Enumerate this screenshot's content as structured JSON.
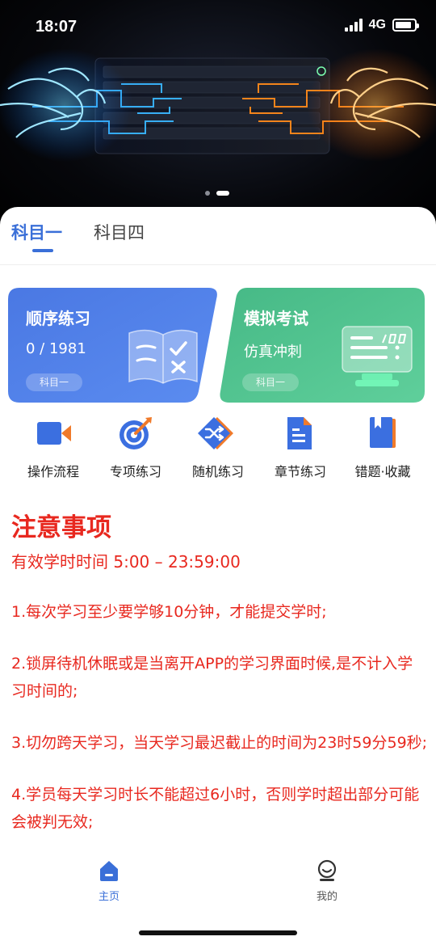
{
  "status_bar": {
    "time": "18:07",
    "network": "4G",
    "battery_level": 0.85
  },
  "banner": {
    "slides": 2,
    "active_slide": 2
  },
  "tabs": [
    {
      "label": "科目一",
      "active": true
    },
    {
      "label": "科目四",
      "active": false
    }
  ],
  "cards": {
    "sequential": {
      "title": "顺序练习",
      "progress": "0 / 1981",
      "tag": "科目一"
    },
    "mock_exam": {
      "title": "模拟考试",
      "subtitle": "仿真冲刺",
      "tag": "科目一"
    }
  },
  "shortcuts": [
    {
      "label": "操作流程",
      "icon": "video-camera-icon"
    },
    {
      "label": "专项练习",
      "icon": "target-icon"
    },
    {
      "label": "随机练习",
      "icon": "shuffle-icon"
    },
    {
      "label": "章节练习",
      "icon": "document-icon"
    },
    {
      "label": "错题·收藏",
      "icon": "bookmark-book-icon"
    }
  ],
  "notice": {
    "title": "注意事项",
    "hours": "有效学时时间 5:00 – 23:59:00",
    "items": [
      "1.每次学习至少要学够10分钟，才能提交学时;",
      "2.锁屏待机休眠或是当离开APP的学习界面时候,是不计入学习时间的;",
      "3.切勿跨天学习，当天学习最迟截止的时间为23时59分59秒;",
      "4.学员每天学习时长不能超过6小时，否则学时超出部分可能会被判无效;"
    ]
  },
  "bottom_nav": [
    {
      "label": "主页",
      "icon": "home-icon",
      "active": true
    },
    {
      "label": "我的",
      "icon": "profile-icon",
      "active": false
    }
  ],
  "colors": {
    "accent": "#3a6fd8",
    "notice_red": "#e8281f",
    "card_blue": "#4f7fe6",
    "card_green": "#4cc08e"
  }
}
